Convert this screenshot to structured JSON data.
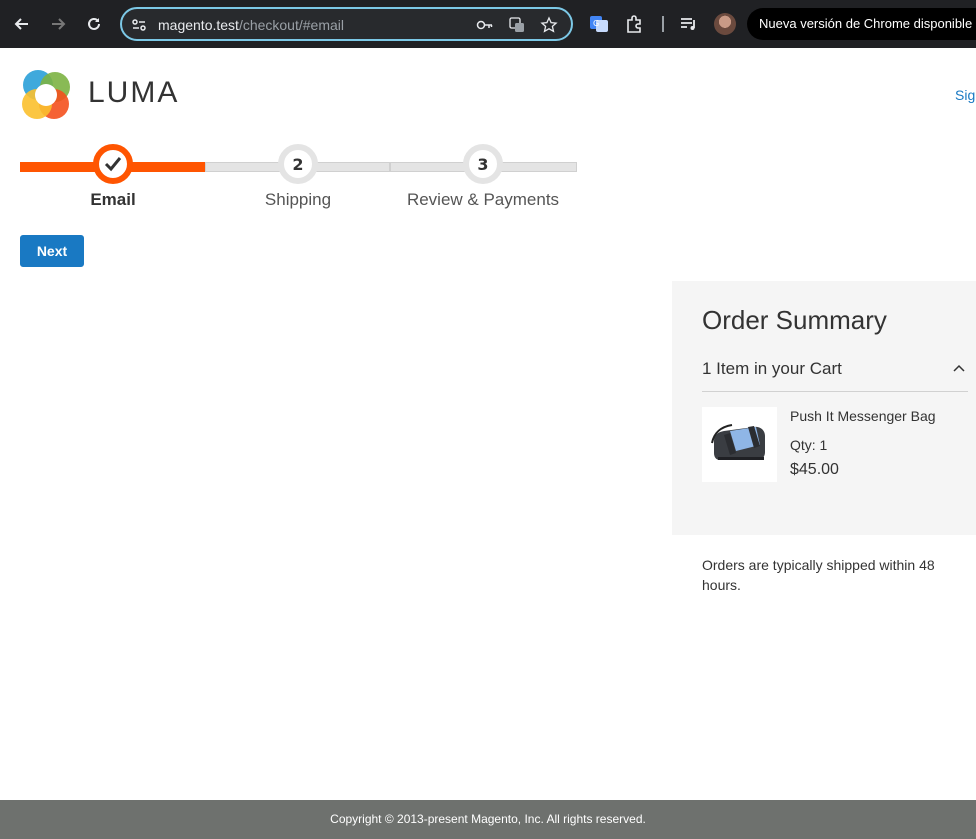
{
  "browser": {
    "url_host": "magento.test",
    "url_path": "/checkout/#email",
    "update_notice": "Nueva versión de Chrome disponible"
  },
  "header": {
    "brand": "LUMA",
    "signin_label": "Sign In"
  },
  "progress": {
    "steps": [
      {
        "number": "",
        "label": "Email",
        "state": "complete"
      },
      {
        "number": "2",
        "label": "Shipping",
        "state": "pending"
      },
      {
        "number": "3",
        "label": "Review & Payments",
        "state": "pending"
      }
    ]
  },
  "actions": {
    "next_label": "Next"
  },
  "summary": {
    "title": "Order Summary",
    "cart_count": "1 Item in your Cart",
    "item": {
      "name": "Push It Messenger Bag",
      "qty": "Qty: 1",
      "price": "$45.00"
    }
  },
  "ship_note": "Orders are typically shipped within 48 hours.",
  "footer": {
    "copyright": "Copyright © 2013-present Magento, Inc. All rights reserved."
  },
  "colors": {
    "accent": "#ff5501",
    "primary_button": "#1979c3",
    "footer_bg": "#6e716e"
  }
}
